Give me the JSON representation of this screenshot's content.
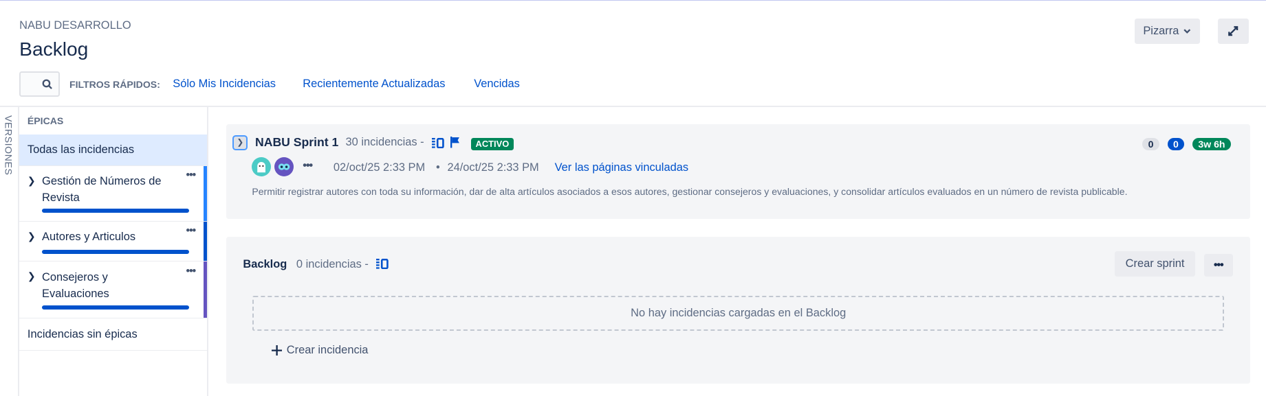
{
  "header": {
    "project": "NABU DESARROLLO",
    "title": "Backlog",
    "board_button": "Pizarra"
  },
  "filters": {
    "label": "FILTROS RÁPIDOS:",
    "links": [
      "Sólo Mis Incidencias",
      "Recientemente Actualizadas",
      "Vencidas"
    ]
  },
  "sidebar": {
    "versions_label": "VERSIONES",
    "epics_label": "ÉPICAS",
    "all_issues": "Todas las incidencias",
    "epics": [
      {
        "name": "Gestión de Números de Revista",
        "color": "#2684ff"
      },
      {
        "name": "Autores y Articulos",
        "color": "#0052cc"
      },
      {
        "name": "Consejeros y Evaluaciones",
        "color": "#6554c0"
      }
    ],
    "no_epic": "Incidencias sin épicas"
  },
  "sprint": {
    "name": "NABU Sprint 1",
    "count": "30 incidencias -",
    "status": "ACTIVO",
    "start": "02/oct/25 2:33 PM",
    "sep": "•",
    "end": "24/oct/25 2:33 PM",
    "link": "Ver las páginas vinculadas",
    "goal": "Permitir registrar autores con toda su información, dar de alta artículos asociados a esos autores, gestionar consejeros y evaluaciones, y consolidar artículos evaluados en un número de revista publicable.",
    "todo": "0",
    "in_progress": "0",
    "estimate": "3w 6h",
    "more": "•••"
  },
  "backlog": {
    "name": "Backlog",
    "count": "0 incidencias -",
    "create_sprint": "Crear sprint",
    "more": "•••",
    "empty": "No hay incidencias cargadas en el Backlog",
    "create_issue": "Crear incidencia"
  }
}
